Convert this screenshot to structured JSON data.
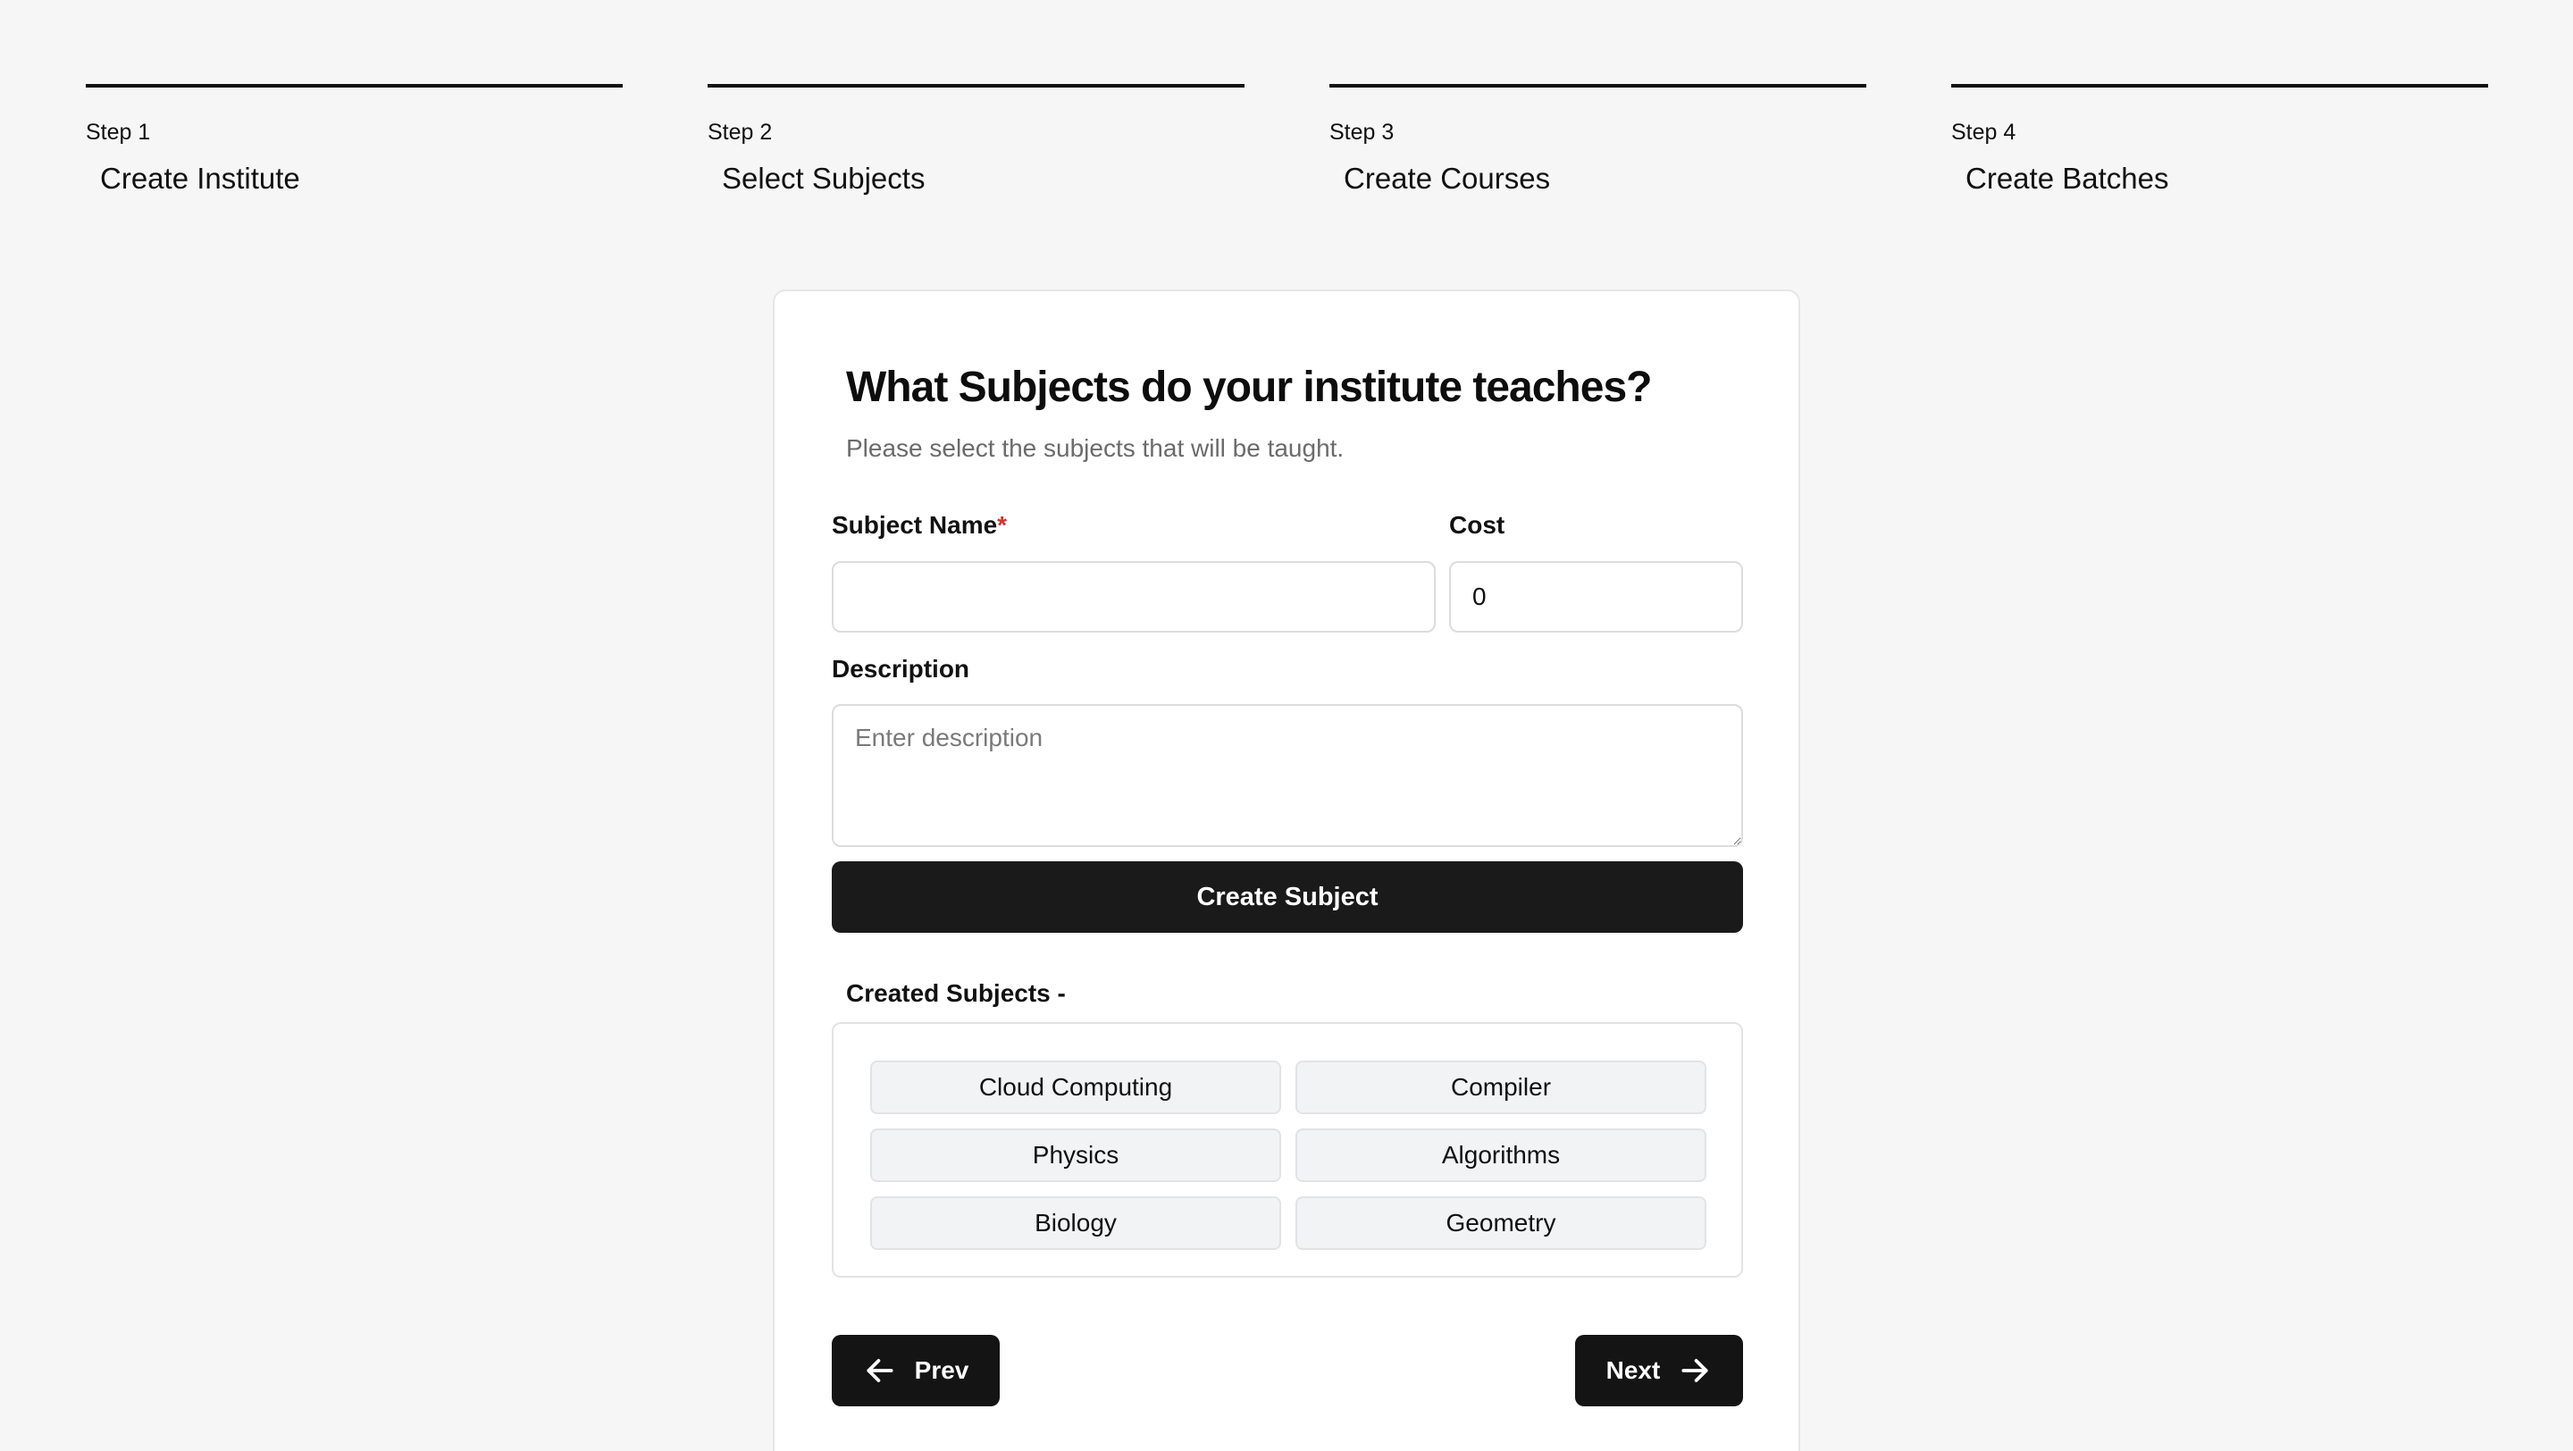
{
  "stepper": {
    "steps": [
      {
        "number": "Step 1",
        "title": "Create Institute"
      },
      {
        "number": "Step 2",
        "title": "Select Subjects"
      },
      {
        "number": "Step 3",
        "title": "Create Courses"
      },
      {
        "number": "Step 4",
        "title": "Create Batches"
      }
    ]
  },
  "form": {
    "heading": "What Subjects do your institute teaches?",
    "subheading": "Please select the subjects that will be taught.",
    "subject_name_label": "Subject Name",
    "required_mark": "*",
    "subject_name_value": "",
    "cost_label": "Cost",
    "cost_value": "0",
    "description_label": "Description",
    "description_placeholder": "Enter description",
    "create_button": "Create Subject"
  },
  "created": {
    "label": "Created Subjects -",
    "subjects": [
      "Cloud Computing",
      "Compiler",
      "Physics",
      "Algorithms",
      "Biology",
      "Geometry"
    ]
  },
  "nav": {
    "prev_label": "Prev",
    "next_label": "Next"
  },
  "colors": {
    "primary": "#1a1a1b",
    "required": "#d32f2f",
    "background": "#f6f6f6"
  }
}
